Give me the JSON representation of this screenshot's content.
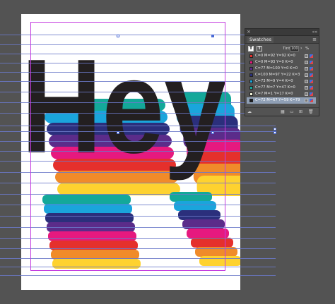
{
  "swatches_panel": {
    "tab_label": "Swatches",
    "close_glyph": "×",
    "collapse_glyph": "««",
    "menu_glyph": "≡",
    "fill_tool_glyph": "T",
    "stroke_tool_glyph": "T",
    "tint_label": "Tint:",
    "tint_value": "100",
    "tint_unit": "%",
    "items": [
      {
        "name": "C=0 M=92 Y=92 K=0",
        "color": "#e5302c"
      },
      {
        "name": "C=0 M=93 Y=0 K=0",
        "color": "#e6197f"
      },
      {
        "name": "C=77 M=100 Y=0 K=0",
        "color": "#5b2c8a"
      },
      {
        "name": "C=100 M=97 Y=22 K=3",
        "color": "#2b2f7c"
      },
      {
        "name": "C=73 M=9 Y=4 K=0",
        "color": "#1aa5dc"
      },
      {
        "name": "C=77 M=7 Y=47 K=0",
        "color": "#14a89a"
      },
      {
        "name": "C=7 M=1 Y=17 K=0",
        "color": "#f1f2d8"
      },
      {
        "name": "C=72 M=67 Y=59 K=79",
        "color": "#1c1c1e",
        "selected": true
      }
    ],
    "footer_icons": [
      "cloud-icon",
      "swatch-view-icon",
      "folder-icon",
      "new-swatch-icon",
      "trash-icon"
    ]
  },
  "artwork": {
    "headline": "Hey",
    "stripe_colors": [
      "#14a89a",
      "#1aa5dc",
      "#2b2f7c",
      "#5b2c8a",
      "#e6197f",
      "#e5302c",
      "#f08b2a",
      "#fed22f"
    ],
    "text_color": "#231f20"
  }
}
